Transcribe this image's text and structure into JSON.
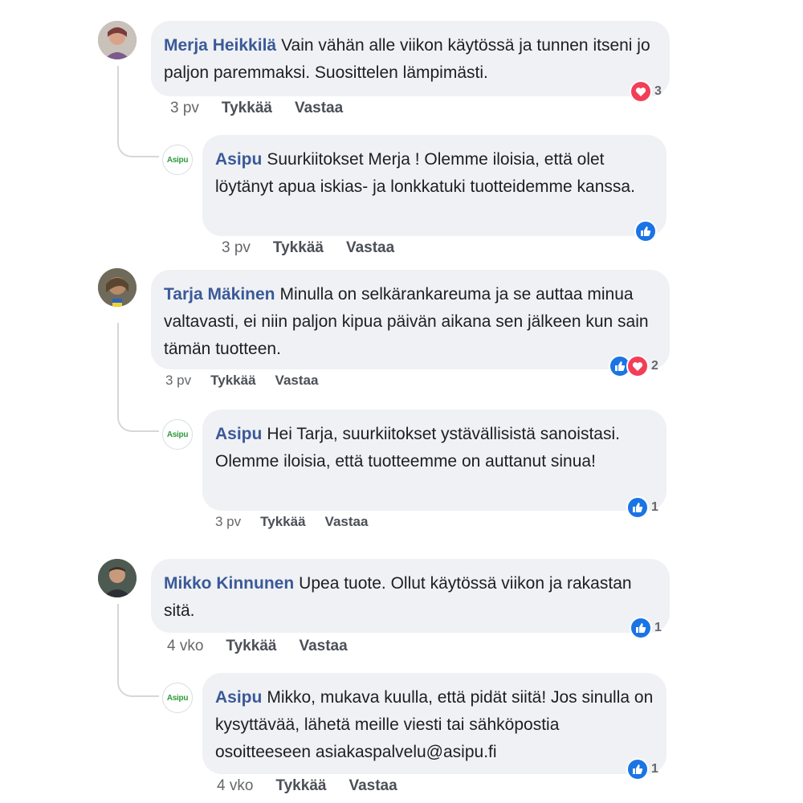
{
  "actions": {
    "like": "Tykkää",
    "reply": "Vastaa"
  },
  "comments": [
    {
      "author": "Merja Heikkilä",
      "text": "Vain vähän alle viikon käytössä ja tunnen itseni jo paljon paremmaksi. Suosittelen lämpimästi.",
      "time": "3 pv",
      "reactions": {
        "types": [
          "love"
        ],
        "count": "3"
      }
    },
    {
      "author": "Asipu",
      "text": "Suurkiitokset Merja ! Olemme iloisia, että olet löytänyt apua iskias- ja lonkkatuki tuotteidemme kanssa.",
      "time": "3 pv",
      "reactions": {
        "types": [
          "like"
        ],
        "count": ""
      }
    },
    {
      "author": "Tarja Mäkinen",
      "text": "Minulla on selkärankareuma ja se auttaa minua valtavasti, ei niin paljon kipua päivän aikana sen jälkeen kun sain tämän tuotteen.",
      "time": "3 pv",
      "reactions": {
        "types": [
          "like",
          "love"
        ],
        "count": "2"
      }
    },
    {
      "author": "Asipu",
      "text": "Hei Tarja, suurkiitokset ystävällisistä sanoistasi. Olemme iloisia, että tuotteemme on auttanut sinua!",
      "time": "3 pv",
      "reactions": {
        "types": [
          "like"
        ],
        "count": "1"
      }
    },
    {
      "author": "Mikko Kinnunen",
      "text": "Upea tuote. Ollut käytössä viikon ja rakastan sitä.",
      "time": "4 vko",
      "reactions": {
        "types": [
          "like"
        ],
        "count": "1"
      }
    },
    {
      "author": "Asipu",
      "text": "Mikko, mukava kuulla, että pidät siitä! Jos sinulla on kysyttävää, lähetä meille viesti tai sähköpostia osoitteeseen asiakaspalvelu@asipu.fi",
      "time": "4 vko",
      "reactions": {
        "types": [
          "like"
        ],
        "count": "1"
      }
    }
  ],
  "asipu_logo": "Asipu",
  "colors": {
    "author": "#3b5998",
    "like": "#1b74e4",
    "love": "#f33e58",
    "bubble": "#eff1f4"
  }
}
